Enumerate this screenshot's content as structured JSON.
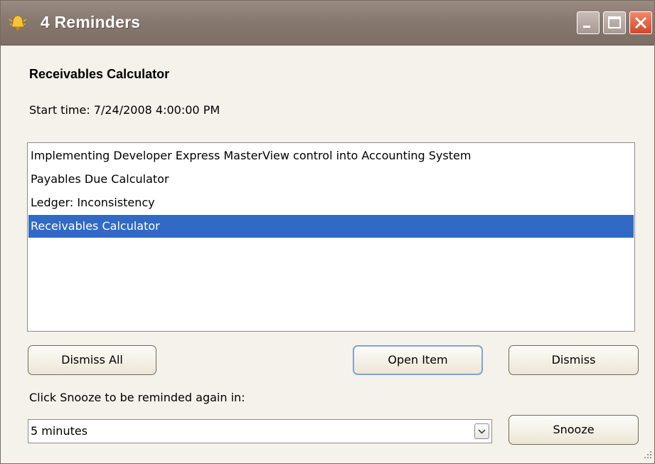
{
  "window": {
    "title": "4 Reminders",
    "icon": "reminder-bell-icon",
    "controls": [
      "minimize-icon",
      "maximize-icon",
      "close-icon"
    ]
  },
  "reminder": {
    "subject": "Receivables Calculator",
    "start_time": "Start time: 7/24/2008 4:00:00 PM"
  },
  "list": {
    "items": [
      "Implementing Developer Express MasterView control into Accounting System",
      "Payables Due Calculator",
      "Ledger: Inconsistency",
      "Receivables Calculator"
    ],
    "selected_index": 3
  },
  "buttons": {
    "dismiss_all": "Dismiss All",
    "open_item": "Open Item",
    "dismiss": "Dismiss",
    "snooze": "Snooze"
  },
  "snooze": {
    "label": "Click Snooze to be reminded again in:",
    "selected": "5 minutes"
  },
  "colors": {
    "titlebar": "#877870",
    "selection": "#316ac5",
    "close_button": "#d4452b"
  }
}
